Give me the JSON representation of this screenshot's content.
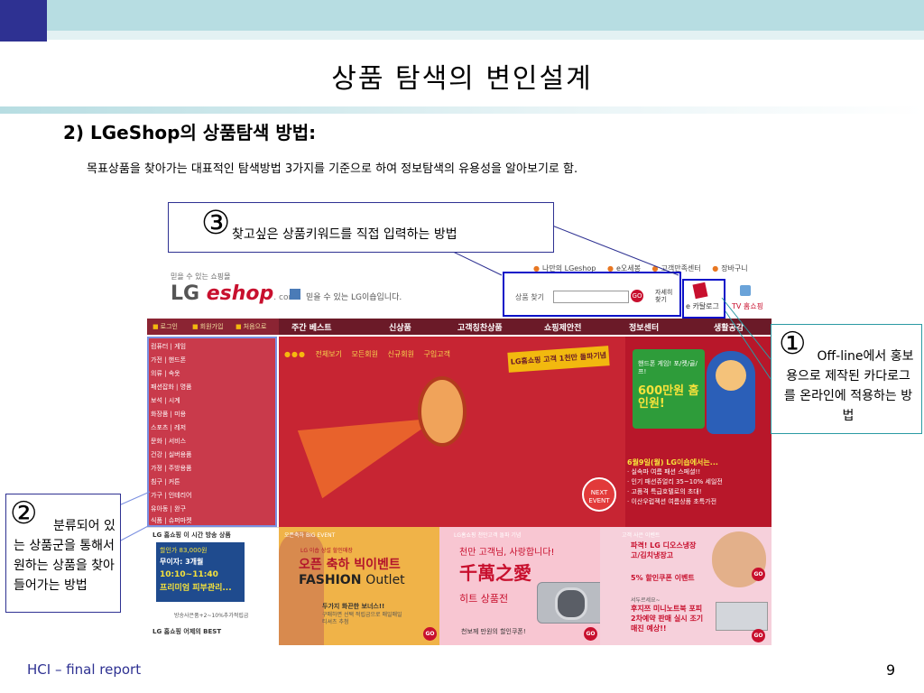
{
  "slide": {
    "title": "상품 탐색의 변인설계",
    "subtitle": "2) LGeShop의 상품탐색 방법:",
    "description": "목표상품을 찾아가는 대표적인 탐색방법 3가지를 기준으로 하여 정보탐색의 유용성을 알아보기로 함.",
    "footer_left": "HCI – final report",
    "page_number": "9"
  },
  "callouts": {
    "c3": {
      "num": "③",
      "text": "찾고싶은 상품키워드를 직접 입력하는 방법"
    },
    "c1": {
      "num": "①",
      "text": "Off-line에서 홍보용으로 제작된 카다로그를 온라인에 적용하는 방법"
    },
    "c2": {
      "num": "②",
      "text": "분류되어 있는 상품군을 통해서 원하는 상품을 찾아 들어가는 방법"
    }
  },
  "site": {
    "logo_small": "믿을 수 있는 쇼핑몰",
    "logo_lg": "LG ",
    "logo_e": "eshop",
    "logo_com": ". com",
    "lg_talk": "믿을 수 있는 LG이숍입니다.",
    "top_links": [
      "나만의 LGeshop",
      "e오세봉",
      "고객만족센터",
      "장바구니"
    ],
    "search": {
      "label": "상품 찾기",
      "value": "",
      "go": "GO",
      "detail": "자세히 찾기"
    },
    "catalog_label": "e 카탈로그",
    "tv_label": "TV 홈쇼핑",
    "nav_mini": [
      "로그인",
      "회원가입",
      "처음으로"
    ],
    "nav_main": [
      "주간 베스트",
      "신상품",
      "고객칭찬상품",
      "쇼핑제안전",
      "정보센터",
      "생활공감"
    ],
    "categories": [
      "컴퓨터 | 게임",
      "가전 | 핸드폰",
      "의류 | 속옷",
      "패션잡화 | 명품",
      "보석 | 시계",
      "화장품 | 미용",
      "스포츠 | 레저",
      "문화 | 서비스",
      "건강 | 실버용품",
      "가정 | 주방용품",
      "침구 | 커튼",
      "가구 | 인테리어",
      "유아동 | 완구",
      "식품 | 슈퍼마켓"
    ],
    "banner": {
      "tabs": [
        "전체보기",
        "모든회원",
        "신규회원",
        "구입고객"
      ],
      "ribbon": "LG홈쇼핑 고객 1천만 돌파기념",
      "next_event": "NEXT EVENT"
    },
    "promo": {
      "small": "핸드폰 게임! 포/켓/골/프!",
      "big": "600만원 홈인원!",
      "list_head": "6월9일(월) LG이숍에서는...",
      "list": [
        "실속파 여름 패션 스페셜!!",
        "인기 패션쥬얼리 35~10% 세일전",
        "고품격 특급호텔로의 초대!",
        "이산우럽젝션 여름상품 초특가전"
      ]
    },
    "live": {
      "title": "LG 홈쇼핑 이 시간 방송 상품",
      "l1": "할인가 83,000원",
      "l2": "무이자: 3개월",
      "l3": "10:10~11:40",
      "l4": "프리미엄 피부관리...",
      "foot": "방송사은품+2~10%추가적립금",
      "best": "LG 홈쇼핑 어제의 BEST"
    },
    "event1": {
      "tag": "오픈축하 BIG EVENT",
      "sub": "LG 이숍 상설 할인매장",
      "t1": "오픈 축하 빅이벤트",
      "t2_a": "FASHION ",
      "t2_b": "Outlet",
      "foot1": "두가지 화끈한 보너스!!",
      "foot2": "구매하면 선택 적립금으로 매일매일 티셔츠 추첨"
    },
    "event2": {
      "tag": "LG홈쇼핑 천만고객 돌파 기념",
      "t1": "천만 고객님, 사랑합니다!",
      "t2": "千萬之愛",
      "t3": "히트 상품전",
      "foot": "천보께 만원의 할인쿠폰!"
    },
    "event3": {
      "tag": "고객 사은 이벤트",
      "t1": "파격! LG 디오스냉장고/김치냉장고",
      "t2": "5% 할인쿠폰 이벤트",
      "t3": "서두르세요~",
      "t4": "후지쯔 미니노트북 포피 2차예약 판매 실시 조기매진 예상!!"
    },
    "go": "GO"
  }
}
